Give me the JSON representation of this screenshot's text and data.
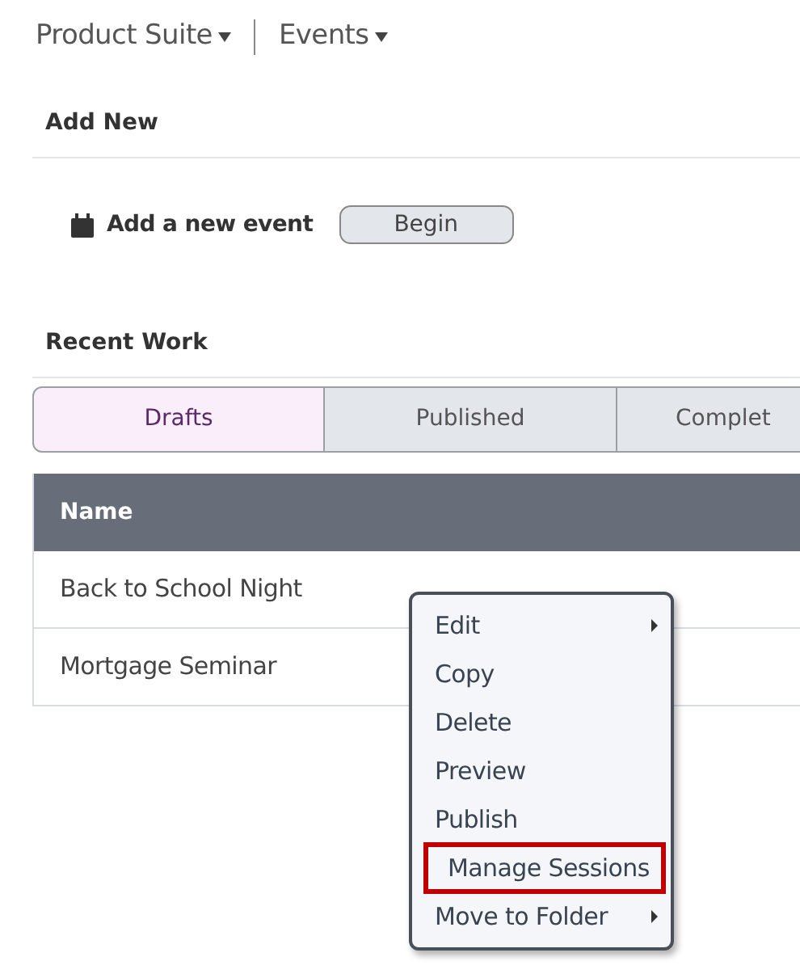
{
  "breadcrumb": [
    {
      "label": "Product Suite"
    },
    {
      "label": "Events"
    }
  ],
  "add_new": {
    "heading": "Add New",
    "label": "Add a new event",
    "button": "Begin"
  },
  "recent_work": {
    "heading": "Recent Work",
    "tabs": [
      {
        "label": "Drafts",
        "selected": true
      },
      {
        "label": "Published",
        "selected": false
      },
      {
        "label": "Complet",
        "selected": false
      }
    ],
    "table": {
      "columns": [
        "Name"
      ],
      "rows": [
        [
          "Back to School Night"
        ],
        [
          "Mortgage Seminar"
        ]
      ]
    }
  },
  "context_menu": {
    "items": [
      {
        "label": "Edit",
        "has_submenu": true,
        "highlighted": false
      },
      {
        "label": "Copy",
        "has_submenu": false,
        "highlighted": false
      },
      {
        "label": "Delete",
        "has_submenu": false,
        "highlighted": false
      },
      {
        "label": "Preview",
        "has_submenu": false,
        "highlighted": false
      },
      {
        "label": "Publish",
        "has_submenu": false,
        "highlighted": false
      },
      {
        "label": "Manage Sessions",
        "has_submenu": false,
        "highlighted": true
      },
      {
        "label": "Move to Folder",
        "has_submenu": true,
        "highlighted": false
      }
    ]
  }
}
